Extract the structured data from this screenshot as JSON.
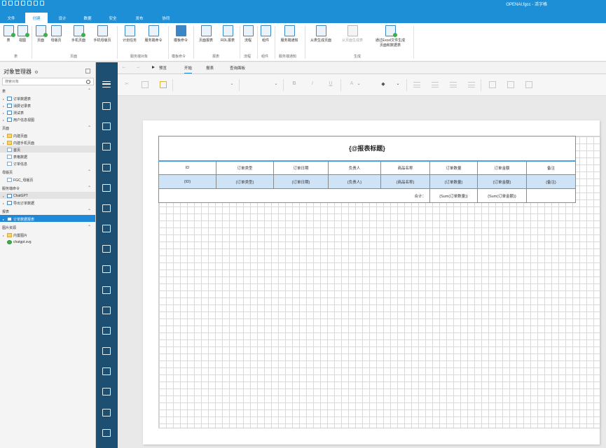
{
  "window": {
    "title": "OPENAI.fgcc - 活字格"
  },
  "menu_tabs": [
    "文件",
    "创建",
    "设计",
    "数据",
    "安全",
    "发布",
    "协同"
  ],
  "active_menu_tab": "创建",
  "ribbon": {
    "buttons": [
      {
        "label": "表",
        "icon": "table-add-icon"
      },
      {
        "label": "视图",
        "icon": "view-add-icon"
      },
      {
        "label": "页面",
        "icon": "page-add-icon"
      },
      {
        "label": "母版页",
        "icon": "master-page-icon"
      },
      {
        "label": "手机页面",
        "icon": "mobile-page-icon"
      },
      {
        "label": "手机母版页",
        "icon": "mobile-master-icon"
      },
      {
        "label": "计划任务",
        "icon": "scheduled-task-icon"
      },
      {
        "label": "服务端命令",
        "icon": "server-command-icon"
      },
      {
        "label": "模板命令",
        "icon": "template-command-icon"
      },
      {
        "label": "页面报表",
        "icon": "page-report-icon"
      },
      {
        "label": "RDL报表",
        "icon": "rdl-report-icon"
      },
      {
        "label": "流程",
        "icon": "workflow-icon"
      },
      {
        "label": "组件",
        "icon": "component-icon"
      },
      {
        "label": "服务端通知",
        "icon": "server-notify-icon"
      },
      {
        "label": "从表生成页面",
        "icon": "gen-from-table-icon"
      },
      {
        "label": "从页面生成表",
        "icon": "gen-from-page-icon"
      },
      {
        "label": "通过Excel文件生成",
        "label2": "页面和数据表",
        "icon": "excel-generate-icon"
      }
    ],
    "groups": [
      "表",
      "页面",
      "服务端对象",
      "模板命令",
      "报表",
      "流程",
      "组件",
      "服务端通知",
      "生成"
    ]
  },
  "object_manager": {
    "title": "对象管理器",
    "search_placeholder": "搜索对象",
    "sections": [
      {
        "name": "表",
        "items": [
          "订单数据表",
          "消费记录表",
          "测试表",
          "用户信息视图"
        ]
      },
      {
        "name": "页面",
        "items": [
          "内建页面",
          "内建手机页面",
          "首页",
          "表格数据",
          "订单信息"
        ]
      },
      {
        "name": "母版页",
        "items": [
          "FGC_母版页"
        ]
      },
      {
        "name": "服务端命令",
        "items": [
          "ChatGPT",
          "导出订单数据"
        ]
      },
      {
        "name": "报表",
        "items": [
          "订单数据报表"
        ]
      },
      {
        "name": "图片资源",
        "items": [
          "内置图片",
          "chatgpt.svg"
        ]
      }
    ]
  },
  "editor": {
    "tabs": [
      "预览",
      "开始",
      "报表",
      "查询面板"
    ],
    "active_tab": "开始",
    "back": "←",
    "forward": "→"
  },
  "report": {
    "title": "{@报表标题}",
    "headers": [
      "ID",
      "订单类型",
      "订单日期",
      "负责人",
      "商品名称",
      "订单数量",
      "订单金额",
      "备注"
    ],
    "data_row": [
      "{ID}",
      "{订单类型}",
      "{订单日期}",
      "{负责人}",
      "{商品名称}",
      "{订单数量}",
      "{订单金额}",
      "{备注}"
    ],
    "summary": {
      "label": "合计：",
      "qty": "{Sum(订单数量)}",
      "amount": "{Sum(订单金额)}"
    }
  }
}
